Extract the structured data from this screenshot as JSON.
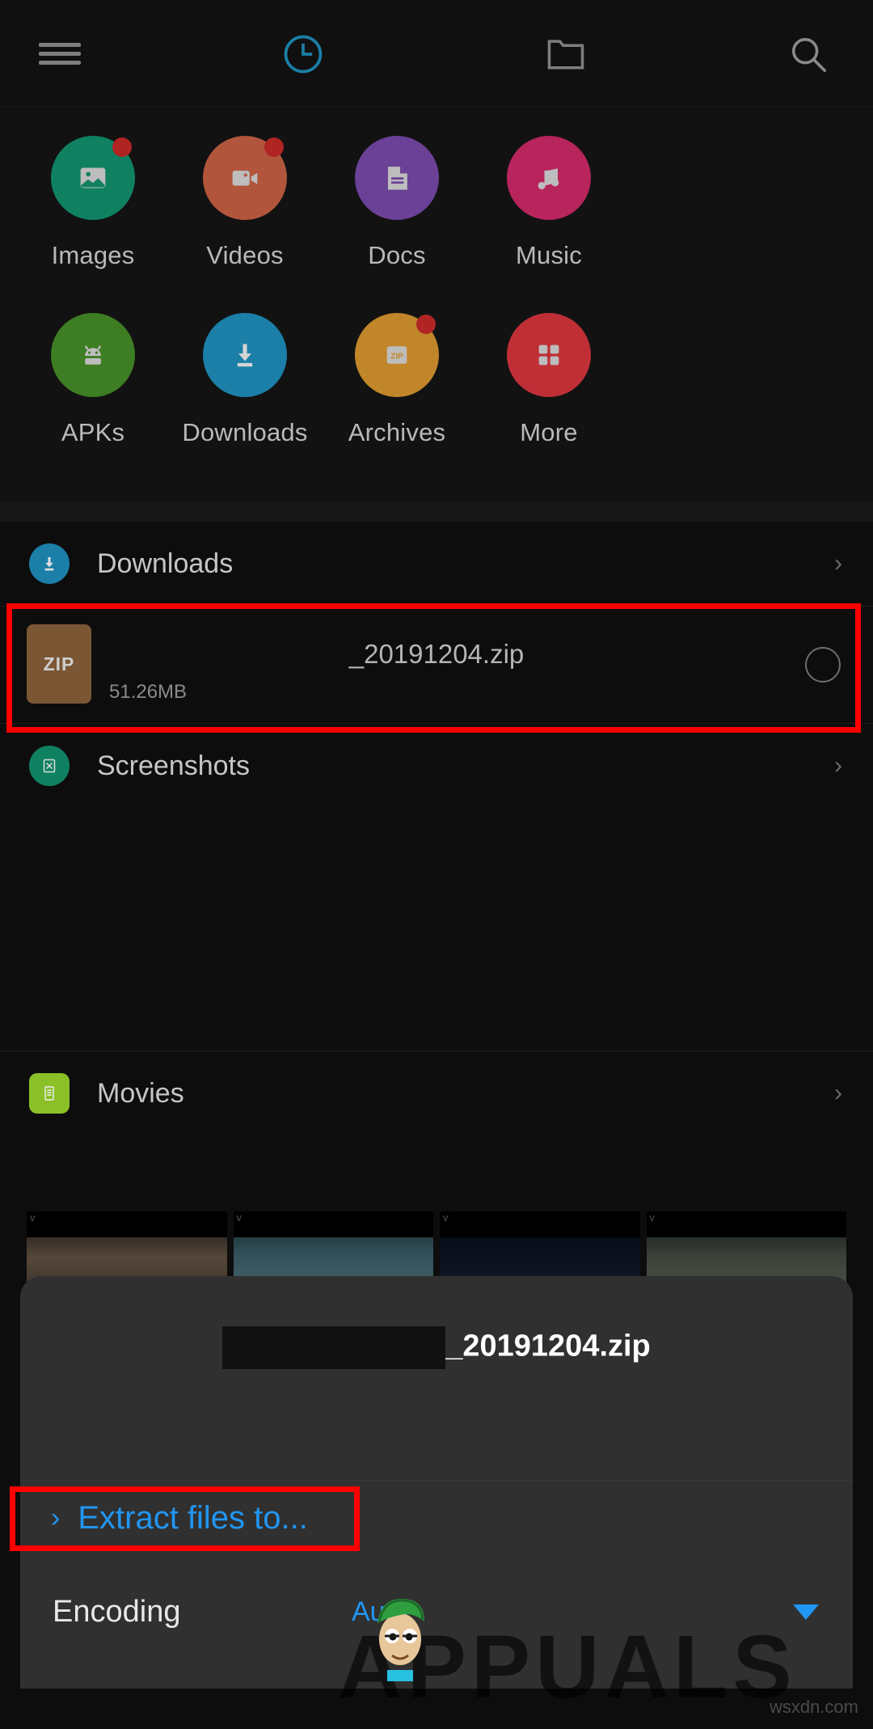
{
  "topbar": {
    "menu_icon": "hamburger-menu-icon",
    "recent_icon": "clock-icon",
    "folder_icon": "folder-icon",
    "search_icon": "search-icon"
  },
  "categories": [
    {
      "label": "Images",
      "icon": "image-icon",
      "color": "#0f8161",
      "badge": true
    },
    {
      "label": "Videos",
      "icon": "video-icon",
      "color": "#b1563c",
      "badge": true
    },
    {
      "label": "Docs",
      "icon": "document-icon",
      "color": "#6a4196",
      "badge": false
    },
    {
      "label": "Music",
      "icon": "music-note-icon",
      "color": "#b8245c",
      "badge": false
    },
    {
      "label": "APKs",
      "icon": "android-icon",
      "color": "#3d7d23",
      "badge": false
    },
    {
      "label": "Downloads",
      "icon": "download-icon",
      "color": "#1b7fa8",
      "badge": false
    },
    {
      "label": "Archives",
      "icon": "zip-icon",
      "color": "#c1862a",
      "badge": true
    },
    {
      "label": "More",
      "icon": "grid-icon",
      "color": "#bf2f35",
      "badge": false
    }
  ],
  "groups": {
    "downloads": {
      "label": "Downloads",
      "icon": "download-icon",
      "color": "#1b7fa8",
      "chevron": "›"
    },
    "screenshots": {
      "label": "Screenshots",
      "icon": "screenshot-icon",
      "color": "#0f8161",
      "chevron": "›"
    },
    "movies": {
      "label": "Movies",
      "icon": "movie-list-icon",
      "color": "#8bc028",
      "chevron": "›"
    }
  },
  "file": {
    "thumb_label": "ZIP",
    "name": "_20191204.zip",
    "size": "51.26MB",
    "selected": false
  },
  "thumbnails": [
    {
      "caption": "v"
    },
    {
      "caption": "v"
    },
    {
      "caption": "v"
    },
    {
      "caption": "v"
    }
  ],
  "sheet": {
    "title_visible": "_20191204.zip",
    "extract_label": "Extract files to...",
    "extract_arrow": "›",
    "encoding_label": "Encoding",
    "encoding_value": "Auto",
    "caret_icon": "caret-down-icon"
  },
  "annotations": {
    "file_row_highlight_color": "#ff0000",
    "extract_highlight_color": "#ff0000"
  },
  "watermarks": {
    "brand": "APPUALS",
    "site": "wsxdn.com"
  },
  "colors": {
    "accent_blue": "#2196f3",
    "background": "#0d0d0d",
    "sheet_background": "#303030"
  }
}
